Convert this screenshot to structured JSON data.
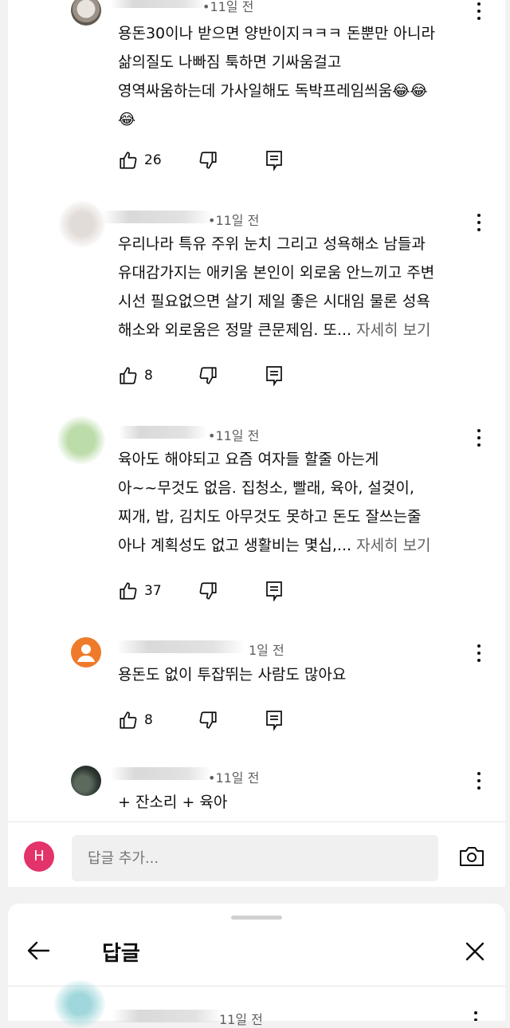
{
  "comments": [
    {
      "time": "•11일 전",
      "lines": [
        "용돈30이나 받으면 양반이지ㅋㅋㅋ 돈뿐만 아니라",
        "삶의질도 나빠짐 툭하면 기싸움걸고",
        "영역싸움하는데 가사일해도 독박프레임씌움😂😂",
        "😂"
      ],
      "likes": "26"
    },
    {
      "time": "•11일 전",
      "lines": [
        "우리나라 특유 주위 눈치 그리고 성욕해소 남들과",
        "유대감가지는 애키움 본인이 외로움 안느끼고 주변",
        "시선 필요없으면 살기 제일 좋은 시대임 물론 성욕",
        "해소와 외로움은 정말 큰문제임. 또..."
      ],
      "more": "자세히 보기",
      "likes": "8"
    },
    {
      "time": "•11일 전",
      "lines": [
        "육아도 해야되고 요즘 여자들 할줄 아는게",
        "아~~무것도 없음. 집청소, 빨래, 육아, 설겆이,",
        "찌개, 밥, 김치도 아무것도 못하고 돈도 잘쓰는줄",
        "아나 계획성도 없고 생활비는 몇십,..."
      ],
      "more": "자세히 보기",
      "likes": "37"
    },
    {
      "time": "1일 전",
      "lines": [
        "용돈도 없이  투잡뛰는 사람도 많아요"
      ],
      "likes": "8"
    },
    {
      "time": "•11일 전",
      "lines": [
        "+ 잔소리 + 육아"
      ]
    }
  ],
  "reply_bar": {
    "user_initial": "H",
    "placeholder": "답글 추가..."
  },
  "sheet": {
    "title": "답글",
    "partial_time": "11일 전"
  },
  "icons": {
    "like": "thumbs-up-icon",
    "dislike": "thumbs-down-icon",
    "reply": "reply-icon",
    "more": "more-vert-icon",
    "camera": "camera-icon",
    "back": "arrow-back-icon",
    "close": "close-icon"
  },
  "colors": {
    "user_avatar": "#e3336b",
    "orange_avatar": "#ef7b2a",
    "secondary_text": "#606060"
  }
}
